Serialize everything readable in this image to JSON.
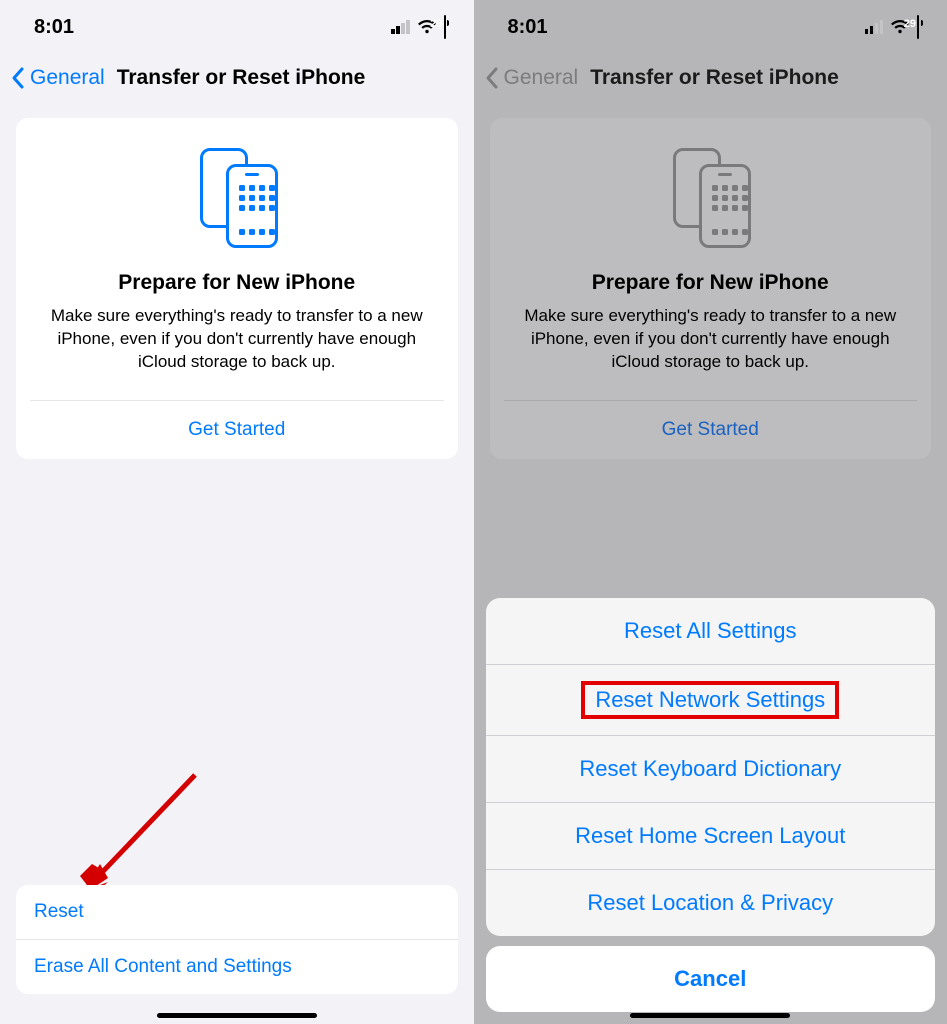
{
  "status_bar": {
    "time": "8:01",
    "battery_percent": "29"
  },
  "nav": {
    "back_label": "General",
    "title": "Transfer or Reset iPhone"
  },
  "hero": {
    "title": "Prepare for New iPhone",
    "description": "Make sure everything's ready to transfer to a new iPhone, even if you don't currently have enough iCloud storage to back up.",
    "cta": "Get Started"
  },
  "left_bottom": {
    "reset": "Reset",
    "erase": "Erase All Content and Settings"
  },
  "sheet": {
    "items": [
      "Reset All Settings",
      "Reset Network Settings",
      "Reset Keyboard Dictionary",
      "Reset Home Screen Layout",
      "Reset Location & Privacy"
    ],
    "cancel": "Cancel",
    "highlighted_index": 1
  }
}
